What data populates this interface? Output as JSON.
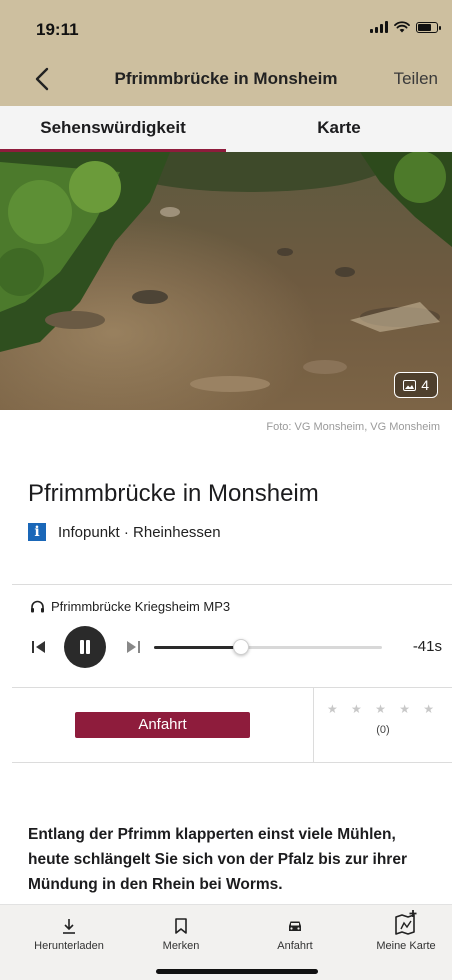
{
  "status": {
    "time": "19:11"
  },
  "nav": {
    "title": "Pfrimmbrücke in Monsheim",
    "share_label": "Teilen"
  },
  "tabs": [
    {
      "label": "Sehenswürdigkeit",
      "active": true
    },
    {
      "label": "Karte",
      "active": false
    }
  ],
  "photo": {
    "count": "4",
    "credit": "Foto: VG Monsheim, VG Monsheim"
  },
  "poi": {
    "title": "Pfrimmbrücke in Monsheim",
    "category": "Infopunkt · Rheinhessen"
  },
  "audio": {
    "label": "Pfrimmbrücke Kriegsheim MP3",
    "remaining": "-41s",
    "progress": 0.38,
    "playing": true
  },
  "actions": {
    "route_label": "Anfahrt",
    "stars": "★ ★ ★ ★ ★",
    "rating_count": "(0)"
  },
  "description": "Entlang der Pfrimm klapperten einst viele Mühlen, heute schlängelt Sie sich von der Pfalz bis zur ihrer Mündung in den Rhein bei Worms.",
  "bottom_nav": [
    {
      "label": "Herunterladen",
      "icon": "download-icon"
    },
    {
      "label": "Merken",
      "icon": "bookmark-icon"
    },
    {
      "label": "Anfahrt",
      "icon": "car-icon"
    },
    {
      "label": "Meine Karte",
      "icon": "map-add-icon"
    }
  ],
  "colors": {
    "header": "#cdbf9f",
    "accent": "#8e1c3c",
    "info": "#1a67b8"
  }
}
